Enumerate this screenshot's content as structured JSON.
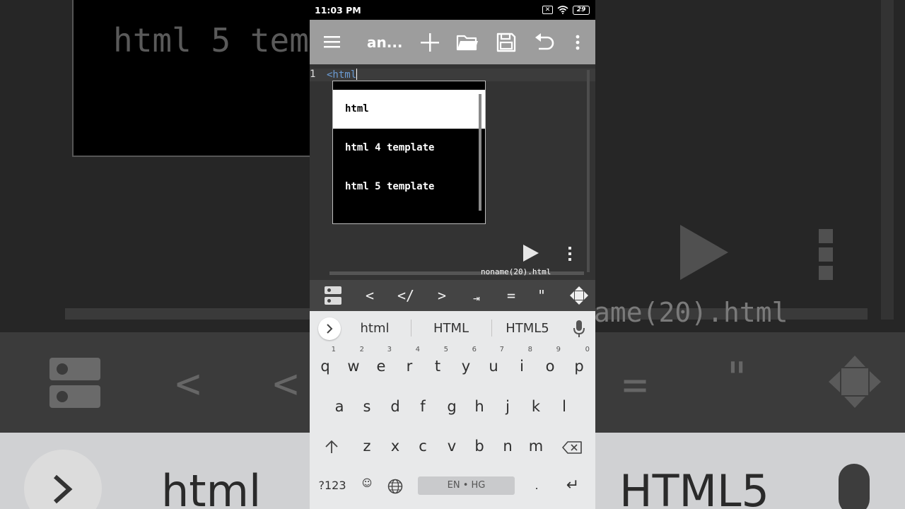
{
  "status_bar": {
    "time": "11:03 PM",
    "battery": "29",
    "sim_icon": "sim-off-icon",
    "wifi_icon": "wifi-icon"
  },
  "app_bar": {
    "menu_icon": "hamburger-menu-icon",
    "title": "an...",
    "actions": [
      "plus-icon",
      "folder-open-icon",
      "save-icon",
      "undo-icon",
      "more-vertical-icon"
    ]
  },
  "editor": {
    "line_number": "1",
    "code": "<html",
    "filename": "noname(20).html",
    "run_icon": "play-icon",
    "menu_icon": "more-vertical-icon"
  },
  "autocomplete": {
    "items": [
      {
        "label": "html",
        "selected": true
      },
      {
        "label": "html 4 template",
        "selected": false
      },
      {
        "label": "html 5 template",
        "selected": false
      }
    ]
  },
  "symbol_toolbar": {
    "toggle_icon": "toggle-panel-icon",
    "keys": [
      "<",
      "</",
      ">",
      "⇥",
      "=",
      "\""
    ],
    "move_icon": "move-arrows-icon"
  },
  "keyboard": {
    "suggestions": [
      "html",
      "HTML",
      "HTML5"
    ],
    "row1": [
      {
        "k": "q",
        "n": "1"
      },
      {
        "k": "w",
        "n": "2"
      },
      {
        "k": "e",
        "n": "3"
      },
      {
        "k": "r",
        "n": "4"
      },
      {
        "k": "t",
        "n": "5"
      },
      {
        "k": "y",
        "n": "6"
      },
      {
        "k": "u",
        "n": "7"
      },
      {
        "k": "i",
        "n": "8"
      },
      {
        "k": "o",
        "n": "9"
      },
      {
        "k": "p",
        "n": "0"
      }
    ],
    "row2": [
      "a",
      "s",
      "d",
      "f",
      "g",
      "h",
      "j",
      "k",
      "l"
    ],
    "row3": [
      "z",
      "x",
      "c",
      "v",
      "b",
      "n",
      "m"
    ],
    "symbols_key": "?123",
    "emoji_key": "☺",
    "space_label": "EN • HG",
    "period_key": ".",
    "enter_key": "↵"
  },
  "background": {
    "code": "html 5 tem",
    "filename": "ame(20).html",
    "suggestions": [
      "html",
      "HTML5"
    ],
    "symbols": [
      "<",
      "<",
      "=",
      "\""
    ]
  }
}
